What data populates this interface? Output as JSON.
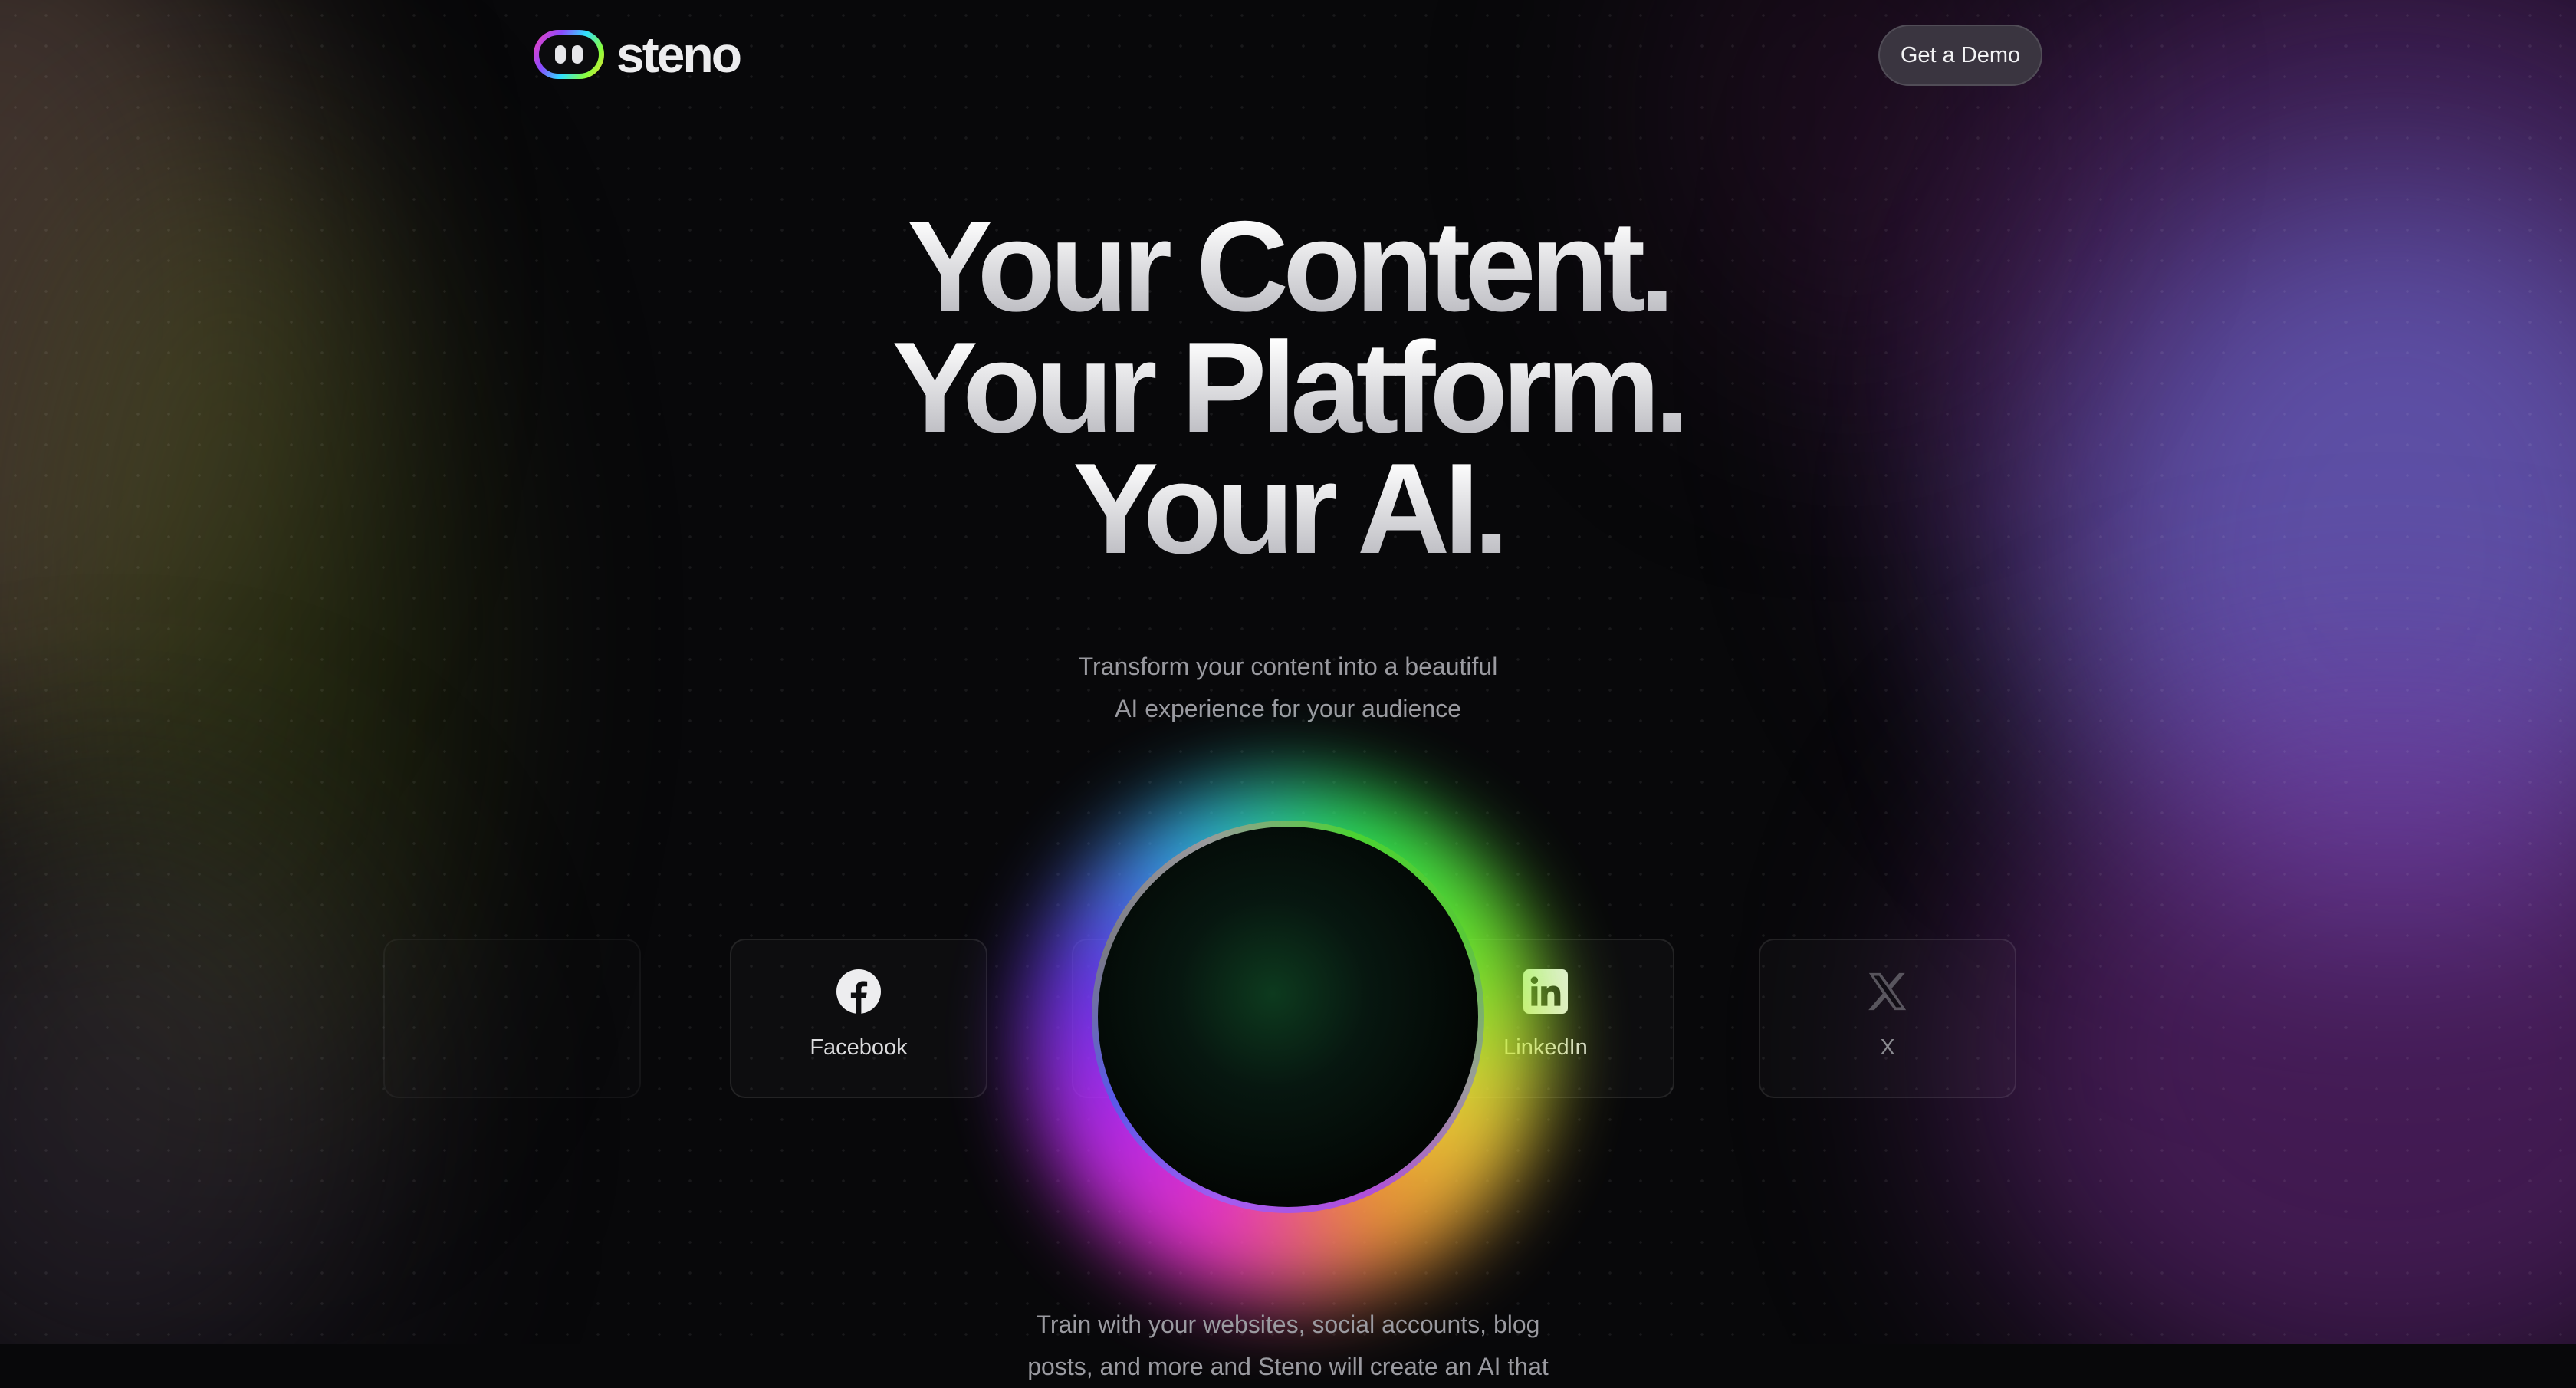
{
  "brand": {
    "name": "steno"
  },
  "header": {
    "cta_label": "Get a Demo"
  },
  "hero": {
    "title_lines": [
      "Your Content.",
      "Your Platform.",
      "Your AI."
    ],
    "subtitle_lines": [
      "Transform your content into a beautiful",
      "AI experience for your audience"
    ]
  },
  "sources": [
    {
      "label": "Facebook",
      "icon": "facebook-icon"
    },
    {
      "label": "LinkedIn",
      "icon": "linkedin-icon"
    },
    {
      "label": "X",
      "icon": "x-icon"
    }
  ],
  "bottom": {
    "lines": [
      "Train with your websites, social accounts, blog",
      "posts, and more and Steno will create an AI that"
    ]
  },
  "colors": {
    "background": "#08080a",
    "cta_background": "#3a3540",
    "heading_top": "#ffffff",
    "heading_bottom": "#b9b9bf",
    "muted_text": "#9a9aa0"
  }
}
